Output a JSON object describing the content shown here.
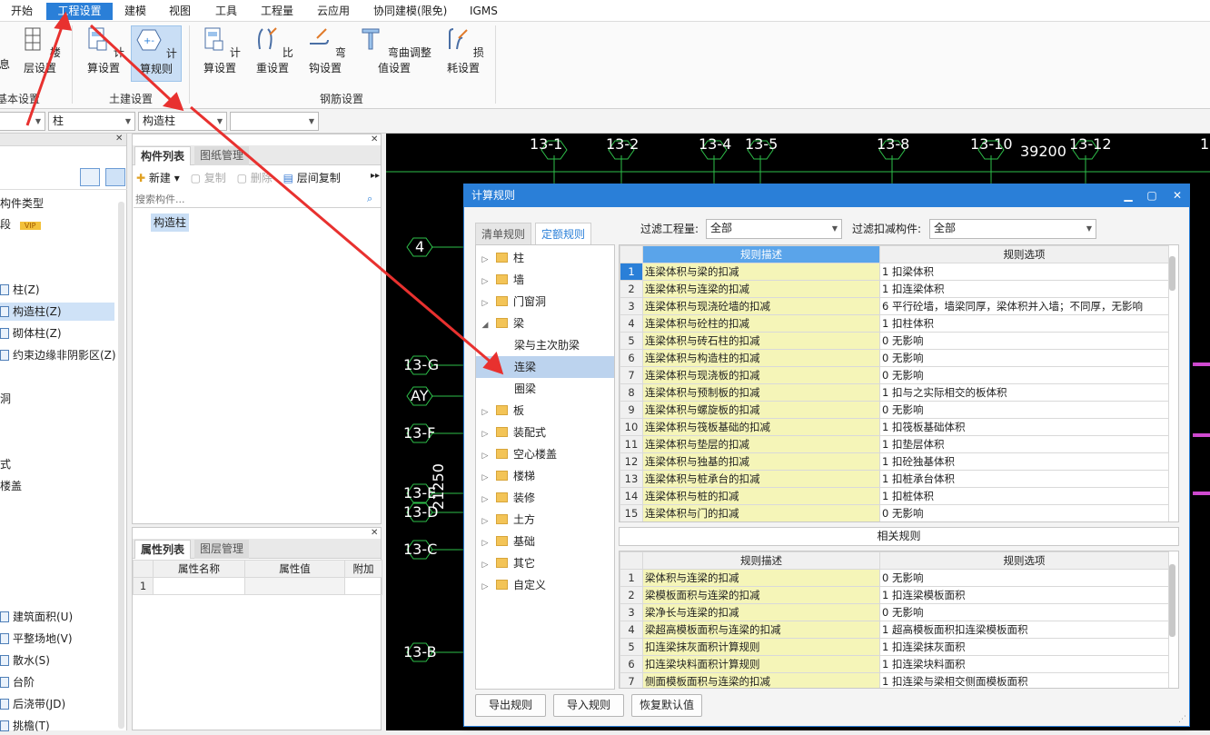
{
  "menu": {
    "items": [
      "开始",
      "工程设置",
      "建模",
      "视图",
      "工具",
      "工程量",
      "云应用",
      "协同建模(限免)",
      "IGMS"
    ],
    "active_index": 1
  },
  "ribbon": {
    "left_cut_1": "息",
    "floor_setting": "楼层设置",
    "group_basic": "基本设置",
    "civil_calc_setting": "计算设置",
    "civil_calc_rule": "计算规则",
    "group_civil": "土建设置",
    "rebar_calc_setting": "计算设置",
    "rebar_ratio_setting": "比重设置",
    "rebar_hook_setting": "弯钩设置",
    "rebar_bend_setting": "弯曲调整值设置",
    "rebar_loss_setting": "损耗设置",
    "group_rebar": "钢筋设置"
  },
  "dropbar": {
    "combo1": "",
    "combo2": "柱",
    "combo3": "构造柱",
    "combo4": ""
  },
  "left_panel": {
    "rows": [
      "构件类型",
      "段",
      "柱(Z)",
      "构造柱(Z)",
      "砌体柱(Z)",
      "约束边缘非阴影区(Z)",
      "洞",
      "式",
      "楼盖",
      "建筑面积(U)",
      "平整场地(V)",
      "散水(S)",
      "台阶",
      "后浇带(JD)",
      "挑檐(T)"
    ],
    "vip": "VIP"
  },
  "component_panel": {
    "tab_list": "构件列表",
    "tab_drawing": "图纸管理",
    "btn_new": "新建",
    "btn_copy": "复制",
    "btn_delete": "删除",
    "btn_floor_copy": "层间复制",
    "search_placeholder": "搜索构件...",
    "selected_item": "构造柱"
  },
  "attr_panel": {
    "tab_attr": "属性列表",
    "tab_layer": "图层管理",
    "col_name": "属性名称",
    "col_value": "属性值",
    "col_extra": "附加",
    "row1": "1"
  },
  "canvas": {
    "top_labels": [
      "13-1",
      "13-2",
      "13-4",
      "13-5",
      "13-8",
      "13-10",
      "39200",
      "13-12",
      "1"
    ],
    "left_labels": [
      "4",
      "13-G",
      "AY",
      "13-F",
      "13-E",
      "13-D",
      "13-C",
      "13-B"
    ],
    "vertical_dim": "21250"
  },
  "dialog": {
    "title": "计算规则",
    "tab_list": "清单规则",
    "tab_quota": "定额规则",
    "filter_project_label": "过滤工程量:",
    "filter_project_value": "全部",
    "filter_deduct_label": "过滤扣减构件:",
    "filter_deduct_value": "全部",
    "categories": [
      {
        "label": "柱",
        "expand": "collapsed"
      },
      {
        "label": "墙",
        "expand": "collapsed"
      },
      {
        "label": "门窗洞",
        "expand": "collapsed"
      },
      {
        "label": "梁",
        "expand": "expanded"
      },
      {
        "label": "梁与主次肋梁",
        "expand": "child"
      },
      {
        "label": "连梁",
        "expand": "child-selected"
      },
      {
        "label": "圈梁",
        "expand": "child"
      },
      {
        "label": "板",
        "expand": "collapsed"
      },
      {
        "label": "装配式",
        "expand": "collapsed"
      },
      {
        "label": "空心楼盖",
        "expand": "collapsed"
      },
      {
        "label": "楼梯",
        "expand": "collapsed"
      },
      {
        "label": "装修",
        "expand": "collapsed"
      },
      {
        "label": "土方",
        "expand": "collapsed"
      },
      {
        "label": "基础",
        "expand": "collapsed"
      },
      {
        "label": "其它",
        "expand": "collapsed"
      },
      {
        "label": "自定义",
        "expand": "collapsed"
      }
    ],
    "main_grid": {
      "col_desc": "规则描述",
      "col_option": "规则选项",
      "rows": [
        {
          "n": "1",
          "desc": "连梁体积与梁的扣减",
          "opt": "1  扣梁体积"
        },
        {
          "n": "2",
          "desc": "连梁体积与连梁的扣减",
          "opt": "1  扣连梁体积"
        },
        {
          "n": "3",
          "desc": "连梁体积与现浇砼墙的扣减",
          "opt": "6  平行砼墙，墙梁同厚，梁体积并入墙；不同厚，无影响"
        },
        {
          "n": "4",
          "desc": "连梁体积与砼柱的扣减",
          "opt": "1  扣柱体积"
        },
        {
          "n": "5",
          "desc": "连梁体积与砖石柱的扣减",
          "opt": "0    无影响"
        },
        {
          "n": "6",
          "desc": "连梁体积与构造柱的扣减",
          "opt": "0    无影响"
        },
        {
          "n": "7",
          "desc": "连梁体积与现浇板的扣减",
          "opt": "0    无影响"
        },
        {
          "n": "8",
          "desc": "连梁体积与预制板的扣减",
          "opt": "1  扣与之实际相交的板体积"
        },
        {
          "n": "9",
          "desc": "连梁体积与螺旋板的扣减",
          "opt": "0    无影响"
        },
        {
          "n": "10",
          "desc": "连梁体积与筏板基础的扣减",
          "opt": "1  扣筏板基础体积"
        },
        {
          "n": "11",
          "desc": "连梁体积与垫层的扣减",
          "opt": "1  扣垫层体积"
        },
        {
          "n": "12",
          "desc": "连梁体积与独基的扣减",
          "opt": "1  扣砼独基体积"
        },
        {
          "n": "13",
          "desc": "连梁体积与桩承台的扣减",
          "opt": "1  扣桩承台体积"
        },
        {
          "n": "14",
          "desc": "连梁体积与桩的扣减",
          "opt": "1  扣桩体积"
        },
        {
          "n": "15",
          "desc": "连梁体积与门的扣减",
          "opt": "0    无影响"
        }
      ]
    },
    "related_label": "相关规则",
    "related_grid": {
      "col_desc": "规则描述",
      "col_option": "规则选项",
      "rows": [
        {
          "n": "1",
          "desc": "梁体积与连梁的扣减",
          "opt": "0    无影响"
        },
        {
          "n": "2",
          "desc": "梁模板面积与连梁的扣减",
          "opt": "1  扣连梁模板面积"
        },
        {
          "n": "3",
          "desc": "梁净长与连梁的扣减",
          "opt": "0    无影响"
        },
        {
          "n": "4",
          "desc": "梁超高模板面积与连梁的扣减",
          "opt": "1  超高模板面积扣连梁模板面积"
        },
        {
          "n": "5",
          "desc": "扣连梁抹灰面积计算规则",
          "opt": "1  扣连梁抹灰面积"
        },
        {
          "n": "6",
          "desc": "扣连梁块料面积计算规则",
          "opt": "1  扣连梁块料面积"
        },
        {
          "n": "7",
          "desc": "侧面模板面积与连梁的扣减",
          "opt": "1  扣连梁与梁相交侧面模板面积"
        }
      ]
    },
    "btn_export": "导出规则",
    "btn_import": "导入规则",
    "btn_restore": "恢复默认值"
  },
  "colors": {
    "accent": "#2a7fd8",
    "annotation_arrow": "#e8312f",
    "grid_desc_bg": "#f5f5b8",
    "cad_green": "#2ec04a"
  }
}
